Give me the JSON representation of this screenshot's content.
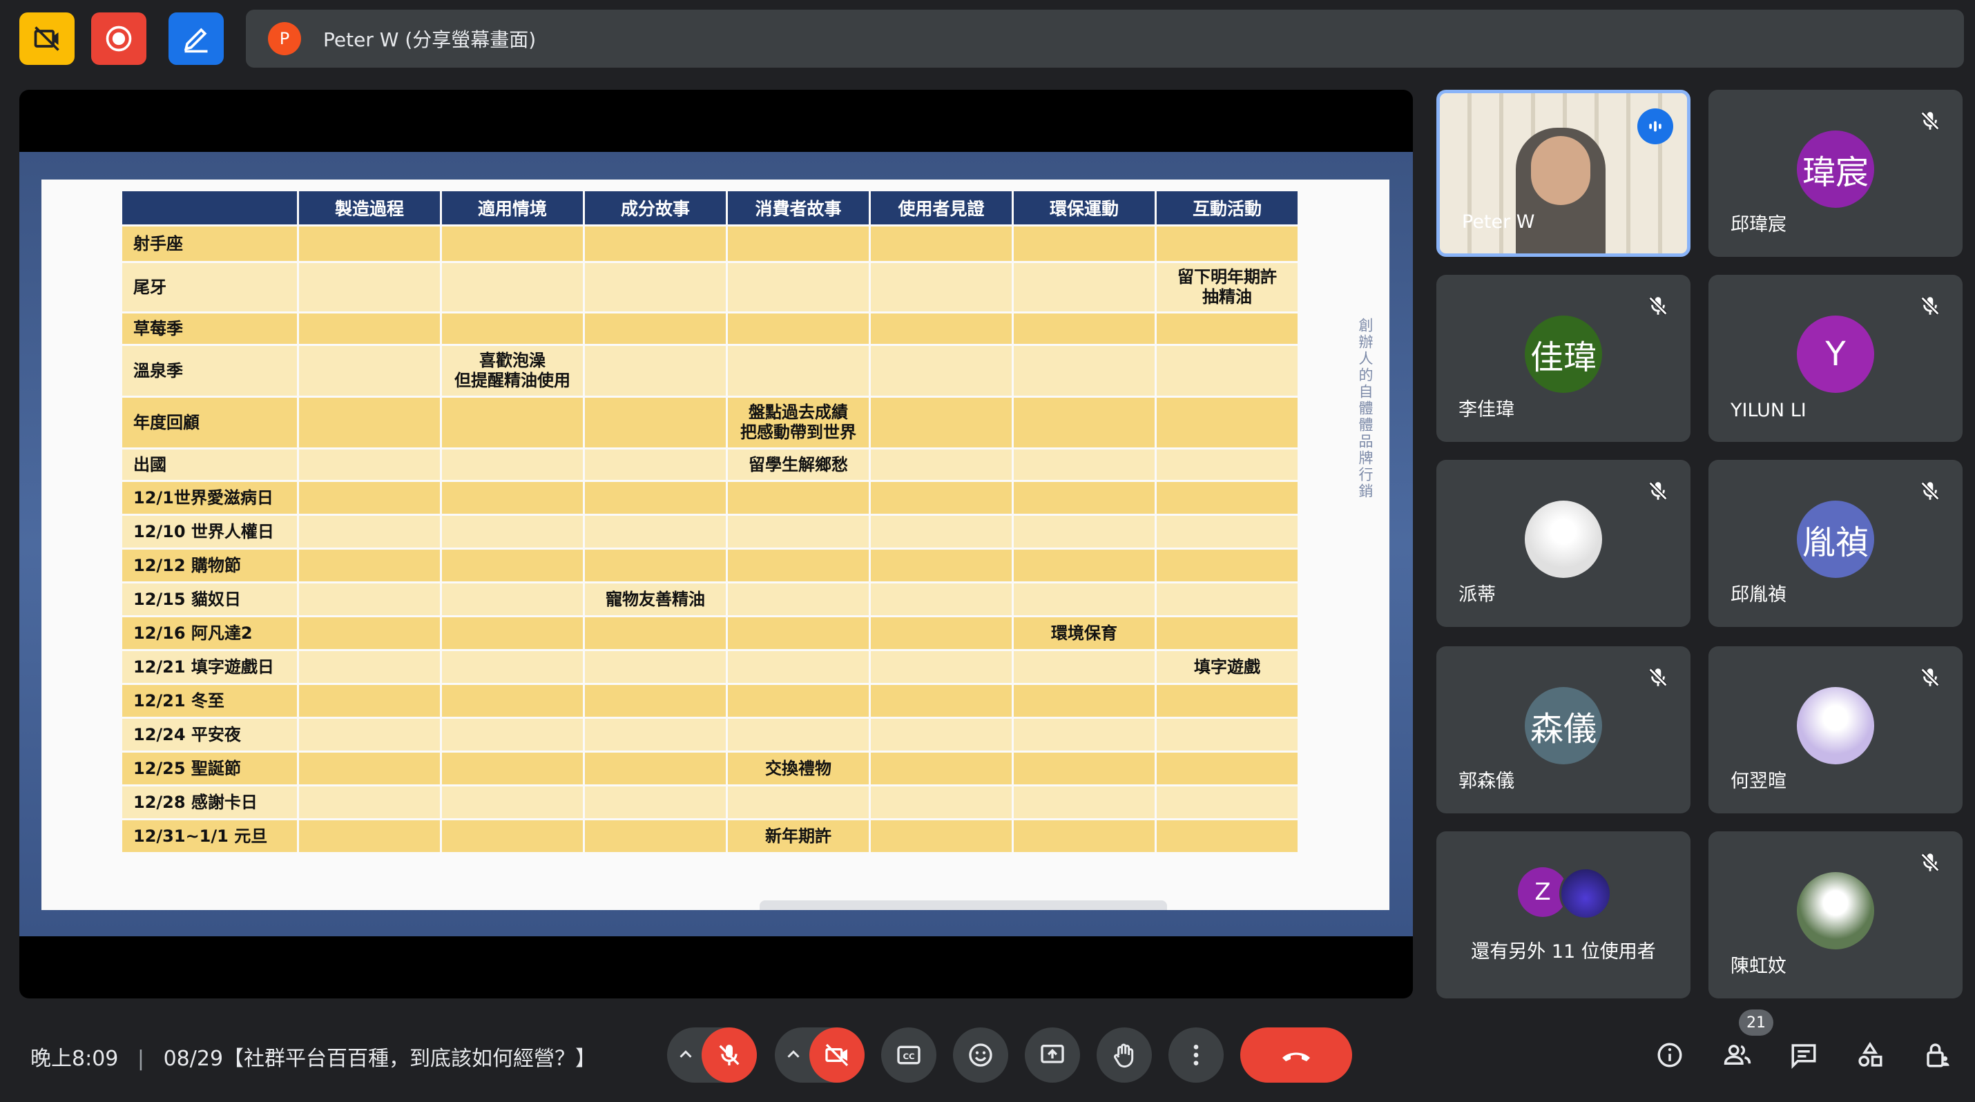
{
  "top_bar": {
    "presenter_initial": "P",
    "presenter_label": "Peter W (分享螢幕畫面)"
  },
  "slide": {
    "columns": [
      "",
      "製造過程",
      "適用情境",
      "成分故事",
      "消費者故事",
      "使用者見證",
      "環保運動",
      "互動活動"
    ],
    "rows": [
      [
        "射手座",
        "",
        "",
        "",
        "",
        "",
        "",
        ""
      ],
      [
        "尾牙",
        "",
        "",
        "",
        "",
        "",
        "",
        "留下明年期許\n抽精油"
      ],
      [
        "草莓季",
        "",
        "",
        "",
        "",
        "",
        "",
        ""
      ],
      [
        "溫泉季",
        "",
        "喜歡泡澡\n但提醒精油使用",
        "",
        "",
        "",
        "",
        ""
      ],
      [
        "年度回顧",
        "",
        "",
        "",
        "盤點過去成績\n把感動帶到世界",
        "",
        "",
        ""
      ],
      [
        "出國",
        "",
        "",
        "",
        "留學生解鄉愁",
        "",
        "",
        ""
      ],
      [
        "12/1世界愛滋病日",
        "",
        "",
        "",
        "",
        "",
        "",
        ""
      ],
      [
        "12/10 世界人權日",
        "",
        "",
        "",
        "",
        "",
        "",
        ""
      ],
      [
        "12/12 購物節",
        "",
        "",
        "",
        "",
        "",
        "",
        ""
      ],
      [
        "12/15 貓奴日",
        "",
        "",
        "寵物友善精油",
        "",
        "",
        "",
        ""
      ],
      [
        "12/16 阿凡達2",
        "",
        "",
        "",
        "",
        "",
        "環境保育",
        ""
      ],
      [
        "12/21 填字遊戲日",
        "",
        "",
        "",
        "",
        "",
        "",
        "填字遊戲"
      ],
      [
        "12/21 冬至",
        "",
        "",
        "",
        "",
        "",
        "",
        ""
      ],
      [
        "12/24 平安夜",
        "",
        "",
        "",
        "",
        "",
        "",
        ""
      ],
      [
        "12/25 聖誕節",
        "",
        "",
        "",
        "交換禮物",
        "",
        "",
        ""
      ],
      [
        "12/28 感謝卡日",
        "",
        "",
        "",
        "",
        "",
        "",
        ""
      ],
      [
        "12/31~1/1 元旦",
        "",
        "",
        "",
        "新年期許",
        "",
        "",
        ""
      ]
    ],
    "side_text": "創辦人的自體體品牌行銷"
  },
  "participants": [
    {
      "name": "Peter W",
      "initials": "",
      "color": "",
      "type": "video"
    },
    {
      "name": "邱瑋宸",
      "initials": "瑋宸",
      "color": "#8e24aa",
      "type": "initials"
    },
    {
      "name": "李佳瑋",
      "initials": "佳瑋",
      "color": "#33691e",
      "type": "initials"
    },
    {
      "name": "YILUN LI",
      "initials": "Y",
      "color": "#9c27b0",
      "type": "initials"
    },
    {
      "name": "派蒂",
      "initials": "",
      "color": "#e0e0e0",
      "type": "photo"
    },
    {
      "name": "邱胤禎",
      "initials": "胤禎",
      "color": "#5c6bc0",
      "type": "initials"
    },
    {
      "name": "郭森儀",
      "initials": "森儀",
      "color": "#546e7a",
      "type": "initials"
    },
    {
      "name": "何翌暄",
      "initials": "",
      "color": "#c7b9e8",
      "type": "photo"
    },
    {
      "name": "陳虹妏",
      "initials": "",
      "color": "#5e7a52",
      "type": "photo"
    }
  ],
  "others_tile": {
    "initial": "Z",
    "label": "還有另外 11 位使用者"
  },
  "bottom_bar": {
    "time": "晚上8:09",
    "separator": "|",
    "meeting_title": "08/29【社群平台百百種，到底該如何經營？】",
    "people_count": "21"
  },
  "colors": {
    "accent": "#1a73e8",
    "danger": "#ea4335",
    "warning": "#fbbc04",
    "surface": "#3c4043",
    "background": "#202124"
  }
}
